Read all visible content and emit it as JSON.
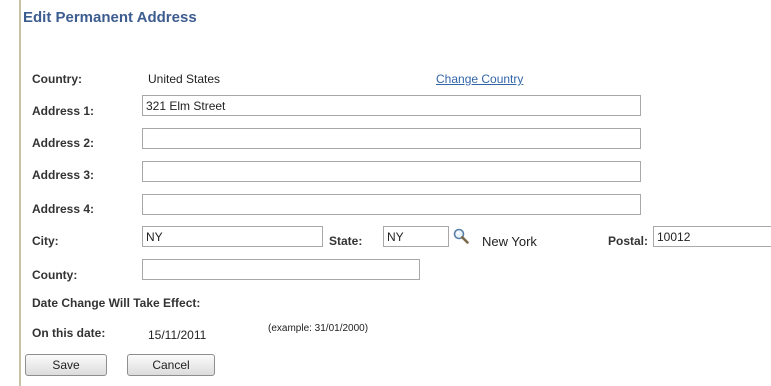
{
  "page": {
    "title": "Edit Permanent Address"
  },
  "country": {
    "label": "Country:",
    "value": "United States",
    "change_link": "Change Country"
  },
  "address": {
    "address1_label": "Address 1:",
    "address1_value": "321 Elm Street",
    "address2_label": "Address 2:",
    "address2_value": "",
    "address3_label": "Address 3:",
    "address3_value": "",
    "address4_label": "Address 4:",
    "address4_value": ""
  },
  "city": {
    "label": "City:",
    "value": "NY"
  },
  "state": {
    "label": "State:",
    "value": "NY",
    "description": "New York",
    "lookup_icon": "magnifier-icon"
  },
  "postal": {
    "label": "Postal:",
    "value": "10012"
  },
  "county": {
    "label": "County:",
    "value": ""
  },
  "effective": {
    "heading": "Date Change Will Take Effect:",
    "date_label": "On this date:",
    "date_value": "15/11/2011",
    "example": "(example: 31/01/2000)"
  },
  "buttons": {
    "save": "Save",
    "cancel": "Cancel"
  }
}
